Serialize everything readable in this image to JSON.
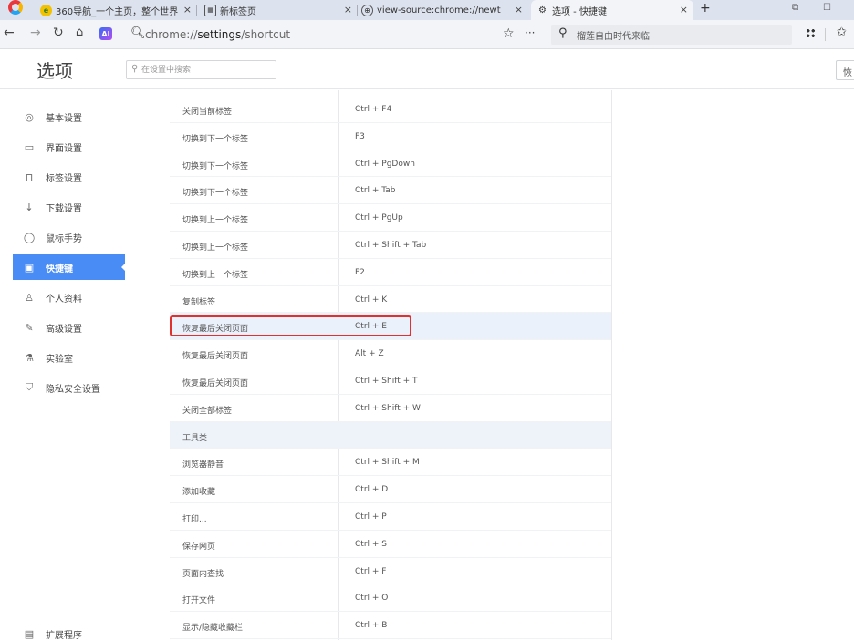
{
  "tabs": [
    {
      "title": "360导航_一个主页，整个世界",
      "icon": "qihoo-orb-icon"
    },
    {
      "title": "新标签页",
      "icon": "newtab-icon"
    },
    {
      "title": "view-source:chrome://newt",
      "icon": "globe-icon"
    },
    {
      "title": "选项 - 快捷键",
      "icon": "gear-icon",
      "active": true
    }
  ],
  "tab_close_glyph": "×",
  "new_tab_glyph": "+",
  "address": {
    "url_host": "chrome://",
    "url_path": "settings",
    "url_tail": "/shortcut",
    "ai_badge": "AI"
  },
  "toolbar_search": {
    "placeholder": "榴莲自由时代来临"
  },
  "settings": {
    "title": "选项",
    "search_placeholder": "在设置中搜索",
    "reset_label": "恢"
  },
  "sidebar": {
    "items": [
      {
        "label": "基本设置",
        "icon": "target-icon"
      },
      {
        "label": "界面设置",
        "icon": "window-icon"
      },
      {
        "label": "标签设置",
        "icon": "tab-icon"
      },
      {
        "label": "下载设置",
        "icon": "download-icon"
      },
      {
        "label": "鼠标手势",
        "icon": "mouse-icon"
      },
      {
        "label": "快捷键",
        "icon": "keyboard-icon",
        "active": true
      },
      {
        "label": "个人资料",
        "icon": "person-icon"
      },
      {
        "label": "高级设置",
        "icon": "wrench-icon"
      },
      {
        "label": "实验室",
        "icon": "flask-icon"
      },
      {
        "label": "隐私安全设置",
        "icon": "shield-icon"
      }
    ],
    "extensions_label": "扩展程序"
  },
  "shortcuts": [
    {
      "action": "关闭当前标签",
      "keys": "Ctrl + F4"
    },
    {
      "action": "切换到下一个标签",
      "keys": "F3"
    },
    {
      "action": "切换到下一个标签",
      "keys": "Ctrl + PgDown"
    },
    {
      "action": "切换到下一个标签",
      "keys": "Ctrl + Tab"
    },
    {
      "action": "切换到上一个标签",
      "keys": "Ctrl + PgUp"
    },
    {
      "action": "切换到上一个标签",
      "keys": "Ctrl + Shift + Tab"
    },
    {
      "action": "切换到上一个标签",
      "keys": "F2"
    },
    {
      "action": "复制标签",
      "keys": "Ctrl + K"
    },
    {
      "action": "恢复最后关闭页面",
      "keys": "Ctrl + E",
      "highlighted": true
    },
    {
      "action": "恢复最后关闭页面",
      "keys": "Alt + Z"
    },
    {
      "action": "恢复最后关闭页面",
      "keys": "Ctrl + Shift + T"
    },
    {
      "action": "关闭全部标签",
      "keys": "Ctrl + Shift + W"
    },
    {
      "action": "工具类",
      "keys": "",
      "section": true
    },
    {
      "action": "浏览器静音",
      "keys": "Ctrl + Shift + M"
    },
    {
      "action": "添加收藏",
      "keys": "Ctrl + D"
    },
    {
      "action": "打印...",
      "keys": "Ctrl + P"
    },
    {
      "action": "保存网页",
      "keys": "Ctrl + S"
    },
    {
      "action": "页面内查找",
      "keys": "Ctrl + F"
    },
    {
      "action": "打开文件",
      "keys": "Ctrl + O"
    },
    {
      "action": "显示/隐藏收藏栏",
      "keys": "Ctrl + B"
    }
  ],
  "colors": {
    "accent": "#4a8cf6",
    "highlight_border": "#e0312e",
    "row_highlight": "#eaf1fb"
  }
}
